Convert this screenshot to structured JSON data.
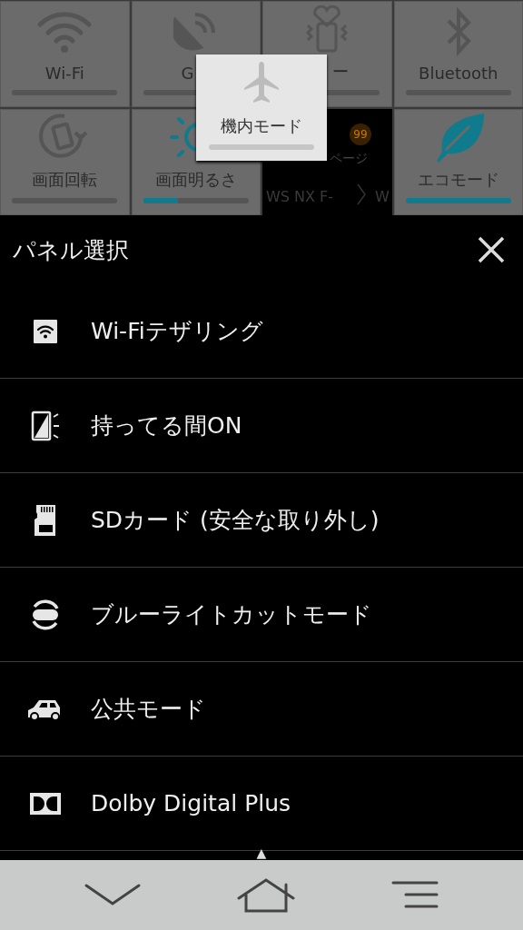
{
  "quick_tiles": [
    {
      "kind": "toggle",
      "label": "Wi-Fi",
      "on": false
    },
    {
      "kind": "toggle",
      "label": "G",
      "on": false
    },
    {
      "kind": "toggle",
      "label": "ー",
      "on": false
    },
    {
      "kind": "toggle",
      "label": "Bluetooth",
      "on": false
    },
    {
      "kind": "toggle",
      "label": "画面回転",
      "on": false
    },
    {
      "kind": "level",
      "label": "画面明るさ",
      "level": 0.33
    },
    {
      "kind": "widget",
      "badge": "99",
      "caption": "ページ",
      "line": "WS NX F-",
      "tail": "W"
    },
    {
      "kind": "toggle",
      "label": "エコモード",
      "on": true
    }
  ],
  "floating_tile": {
    "label": "機内モード",
    "on": false
  },
  "panel": {
    "title": "パネル選択",
    "items": [
      "Wi-Fiテザリング",
      "持ってる間ON",
      "SDカード (安全な取り外し)",
      "ブルーライトカットモード",
      "公共モード",
      "Dolby Digital Plus"
    ],
    "more_arrow": "▲"
  }
}
